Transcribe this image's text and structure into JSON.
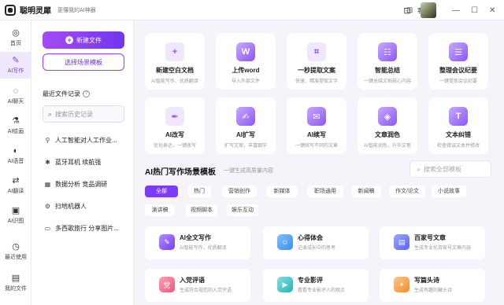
{
  "app": {
    "name": "聪明灵犀",
    "slogan": "更懂我的AI神器",
    "service_label": "客服"
  },
  "rail": [
    {
      "icon": "home-icon",
      "glyph": "◎",
      "label": "首页"
    },
    {
      "icon": "ai-writing-icon",
      "glyph": "✎",
      "label": "AI写作"
    },
    {
      "icon": "ai-chat-icon",
      "glyph": "◌",
      "label": "AI聊天"
    },
    {
      "icon": "ai-painting-icon",
      "glyph": "⚗",
      "label": "AI绘画"
    },
    {
      "icon": "ai-voice-icon",
      "glyph": "◐",
      "label": "AI语音"
    },
    {
      "icon": "ai-translate-icon",
      "glyph": "⇄",
      "label": "AI翻译"
    },
    {
      "icon": "ai-recognition-icon",
      "glyph": "▣",
      "label": "AI识图"
    },
    {
      "icon": "recent-icon",
      "glyph": "◷",
      "label": "最近使用"
    },
    {
      "icon": "my-files-icon",
      "glyph": "▤",
      "label": "我的文件"
    }
  ],
  "panel": {
    "new_doc": "新建文件",
    "choose_scene": "选择场景模板",
    "recent_title": "最近文件记录",
    "search_placeholder": "搜索历史记录",
    "recent_items": [
      {
        "icon": "person-icon",
        "glyph": "⚲",
        "label": "人工智能对人工作业..."
      },
      {
        "icon": "bluetooth-icon",
        "glyph": "✱",
        "label": "蓝牙耳机 续航强"
      },
      {
        "icon": "data-analysis-icon",
        "glyph": "▦",
        "label": "数据分析 竞品调研"
      },
      {
        "icon": "robot-icon",
        "glyph": "⚙",
        "label": "扫地机器人"
      },
      {
        "icon": "document-icon",
        "glyph": "▭",
        "label": "多西歌旅行 分享图片..."
      }
    ]
  },
  "tools": [
    {
      "icon": "blank-doc-icon",
      "glyph": "+",
      "title": "新建空白文档",
      "sub": "AI智能写作、优质翻译"
    },
    {
      "icon": "word-icon",
      "glyph": "W",
      "title": "上传word",
      "sub": "导入外部文件"
    },
    {
      "icon": "scan-text-icon",
      "glyph": "⌗",
      "title": "一秒提取文案",
      "sub": "快速、精准提取文字"
    },
    {
      "icon": "smart-summary-icon",
      "glyph": "☷",
      "title": "智能总结",
      "sub": "一键总结文档核心内容"
    },
    {
      "icon": "meeting-notes-icon",
      "glyph": "☰",
      "title": "整理会议纪要",
      "sub": "一键提炼会议纪要"
    },
    {
      "icon": "ai-rewrite-icon",
      "glyph": "✒",
      "title": "AI改写",
      "sub": "优化表达，一键改写"
    },
    {
      "icon": "ai-expand-icon",
      "glyph": "✍",
      "title": "AI扩写",
      "sub": "扩写文案，丰富细节"
    },
    {
      "icon": "ai-continue-icon",
      "glyph": "✉",
      "title": "AI续写",
      "sub": "一键续写不同的文章"
    },
    {
      "icon": "polish-icon",
      "glyph": "◈",
      "title": "文章润色",
      "sub": "AI智能润色，升华文笔"
    },
    {
      "icon": "text-correction-icon",
      "glyph": "T",
      "title": "文本纠错",
      "sub": "检查错误文本并修改"
    }
  ],
  "section": {
    "title": "AI热门写作场景模板",
    "subtitle": "一键生成高质量内容",
    "search_placeholder": "搜索全部模板"
  },
  "chips": [
    "全部",
    "热门",
    "营销创作",
    "新媒体",
    "职场通用",
    "新闻稿",
    "作文/论文",
    "小说故事",
    "演讲稿",
    "视频脚本",
    "娱乐互动"
  ],
  "templates": [
    {
      "icon": "ai-full-text-icon",
      "glyph": "✎",
      "color": "i-purple",
      "title": "AI全文写作",
      "sub": "AI智能写作，优质翻译"
    },
    {
      "icon": "reflection-icon",
      "glyph": "☺",
      "color": "i-blue",
      "title": "心得体会",
      "sub": "记录成长中的思考"
    },
    {
      "icon": "baijiahao-icon",
      "glyph": "▤",
      "color": "i-indigo",
      "title": "百家号文章",
      "sub": "生成专业化百家号文章内容"
    },
    {
      "icon": "party-review-icon",
      "glyph": "党",
      "color": "i-pink",
      "title": "入党评语",
      "sub": "生成符合规范的入党评语"
    },
    {
      "icon": "film-review-icon",
      "glyph": "▶",
      "color": "i-teal",
      "title": "专业影评",
      "sub": "看看专业影评人的观点"
    },
    {
      "icon": "headline-icon",
      "glyph": "✦",
      "color": "i-orange",
      "title": "写篇头诗",
      "sub": "生成有趣的藏头诗"
    }
  ]
}
